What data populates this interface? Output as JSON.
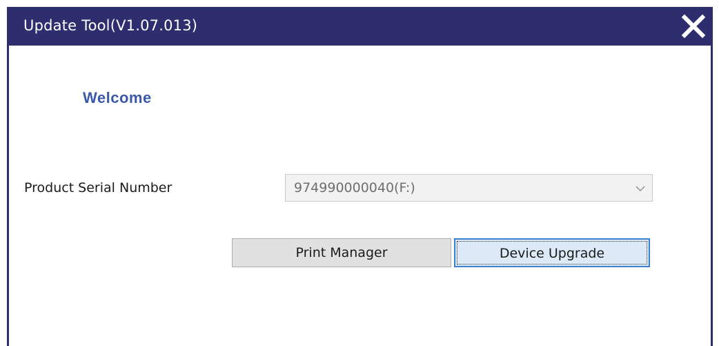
{
  "window": {
    "title": "Update Tool(V1.07.013)"
  },
  "icons": {
    "close": "close-icon",
    "dropdown": "chevron-down-icon"
  },
  "colors": {
    "titlebar": "#2e2e6f",
    "welcome_text": "#3a5aa8",
    "focus_border": "#3c7fd1"
  },
  "main": {
    "welcome": "Welcome",
    "serial_label": "Product Serial Number",
    "serial_value": "974990000040(F:)",
    "buttons": {
      "print_manager": "Print Manager",
      "device_upgrade": "Device Upgrade"
    }
  }
}
